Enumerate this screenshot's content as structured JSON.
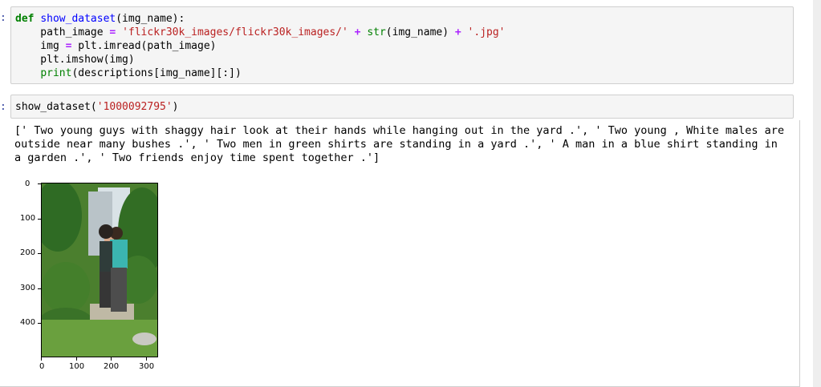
{
  "cells": [
    {
      "prompt": ":",
      "code": {
        "def_kw": "def",
        "fn_name": "show_dataset",
        "sig_rest": "(img_name):",
        "line2_a": "    path_image ",
        "eq": "=",
        "str1": "'flickr30k_images/flickr30k_images/'",
        "plus": "+",
        "bi_str": "str",
        "call_rest": "(img_name) ",
        "str2": "'.jpg'",
        "line3_a": "    img ",
        "line3_b": " plt.imread(path_image)",
        "line4": "    plt.imshow(img)",
        "bi_print": "print",
        "line5_rest": "(descriptions[img_name][:])"
      }
    },
    {
      "prompt": ":",
      "code": {
        "call_fn": "show_dataset",
        "open": "(",
        "arg": "'1000092795'",
        "close": ")"
      }
    }
  ],
  "output": {
    "text": "[' Two young guys with shaggy hair look at their hands while hanging out in the yard .', ' Two young , White males are outside near many bushes .', ' Two men in green shirts are standing in a yard .', ' A man in a blue shirt standing in a garden .', ' Two friends enjoy time spent together .']"
  },
  "plot": {
    "y_ticks": [
      "0",
      "100",
      "200",
      "300",
      "400"
    ],
    "x_ticks": [
      "0",
      "100",
      "200",
      "300"
    ],
    "image_desc_icon": "photo-icon"
  }
}
